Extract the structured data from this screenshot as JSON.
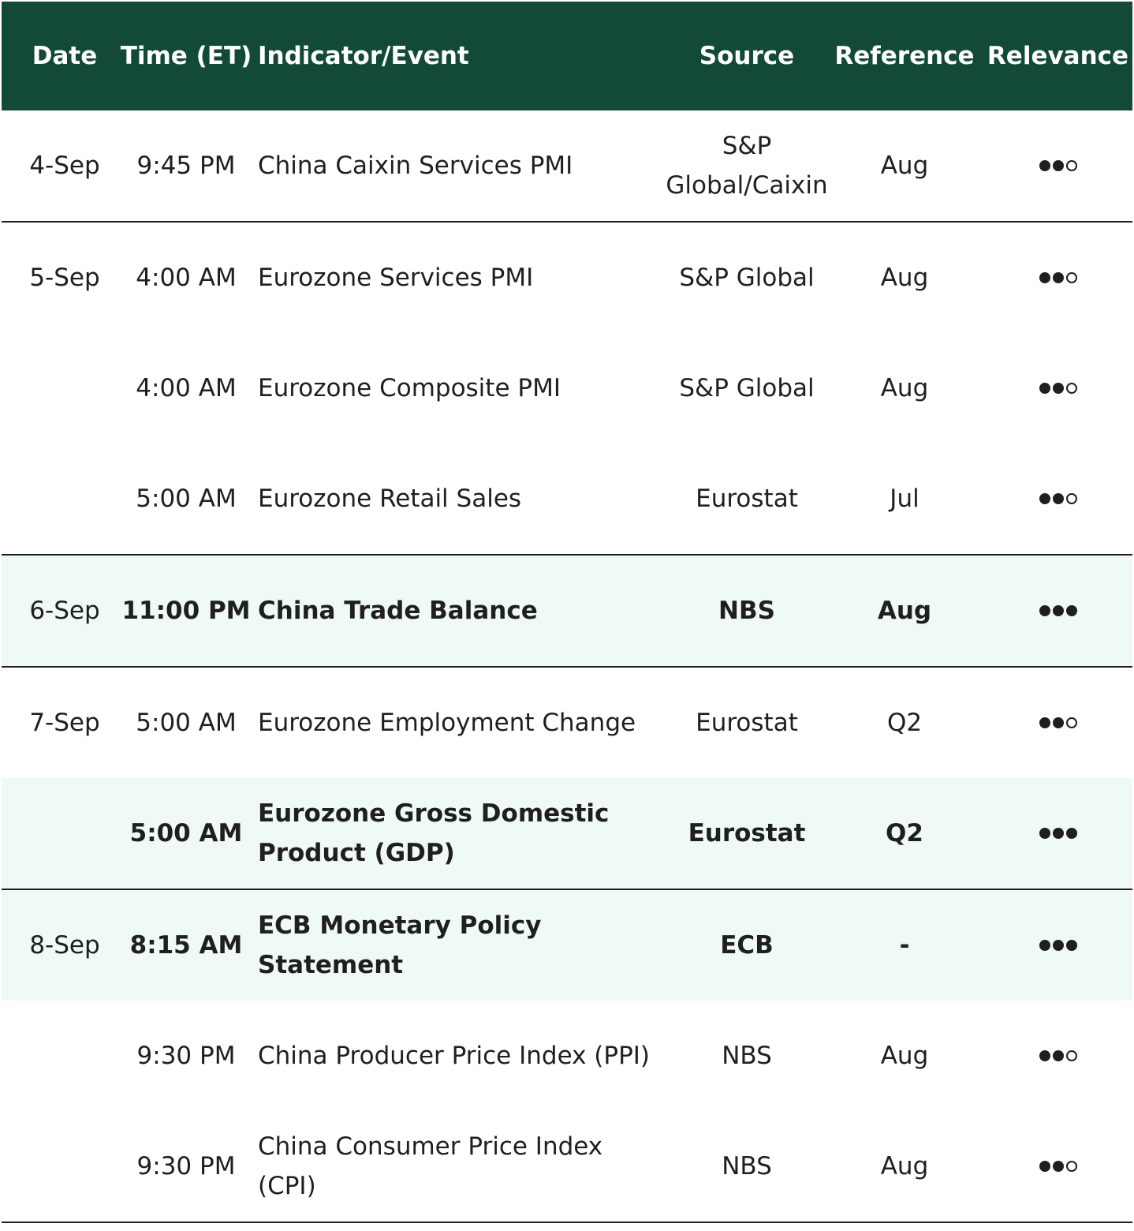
{
  "header": {
    "date": "Date",
    "time": "Time (ET)",
    "event": "Indicator/Event",
    "source": "Source",
    "reference": "Reference",
    "relevance": "Relevance"
  },
  "rows": [
    {
      "date": "4-Sep",
      "time": "9:45 PM",
      "event": "China Caixin Services PMI",
      "source": "S&P Global/Caixin",
      "reference": "Aug",
      "relevance": 2,
      "highlight": false,
      "bold": false,
      "separator_after": true
    },
    {
      "date": "5-Sep",
      "time": "4:00 AM",
      "event": "Eurozone Services PMI",
      "source": "S&P Global",
      "reference": "Aug",
      "relevance": 2,
      "highlight": false,
      "bold": false,
      "separator_after": false
    },
    {
      "date": "",
      "time": "4:00 AM",
      "event": "Eurozone Composite PMI",
      "source": "S&P Global",
      "reference": "Aug",
      "relevance": 2,
      "highlight": false,
      "bold": false,
      "separator_after": false
    },
    {
      "date": "",
      "time": "5:00 AM",
      "event": "Eurozone Retail Sales",
      "source": "Eurostat",
      "reference": "Jul",
      "relevance": 2,
      "highlight": false,
      "bold": false,
      "separator_after": true
    },
    {
      "date": "6-Sep",
      "time": "11:00 PM",
      "event": "China Trade Balance",
      "source": "NBS",
      "reference": "Aug",
      "relevance": 3,
      "highlight": true,
      "bold": true,
      "separator_after": true
    },
    {
      "date": "7-Sep",
      "time": "5:00 AM",
      "event": "Eurozone Employment Change",
      "source": "Eurostat",
      "reference": "Q2",
      "relevance": 2,
      "highlight": false,
      "bold": false,
      "separator_after": false
    },
    {
      "date": "",
      "time": "5:00 AM",
      "event": "Eurozone Gross Domestic Product (GDP)",
      "source": "Eurostat",
      "reference": "Q2",
      "relevance": 3,
      "highlight": true,
      "bold": true,
      "separator_after": true
    },
    {
      "date": "8-Sep",
      "time": "8:15 AM",
      "event": "ECB Monetary Policy Statement",
      "source": "ECB",
      "reference": "-",
      "relevance": 3,
      "highlight": true,
      "bold": true,
      "separator_after": false
    },
    {
      "date": "",
      "time": "9:30 PM",
      "event": "China Producer Price Index (PPI)",
      "source": "NBS",
      "reference": "Aug",
      "relevance": 2,
      "highlight": false,
      "bold": false,
      "separator_after": false
    },
    {
      "date": "",
      "time": "9:30 PM",
      "event": "China Consumer Price Index (CPI)",
      "source": "NBS",
      "reference": "Aug",
      "relevance": 2,
      "highlight": false,
      "bold": false,
      "separator_after": true
    }
  ],
  "relevance_max": 3,
  "colors": {
    "header_bg": "#134a37",
    "highlight_bg": "#effaf5",
    "text": "#1f1f1f"
  }
}
